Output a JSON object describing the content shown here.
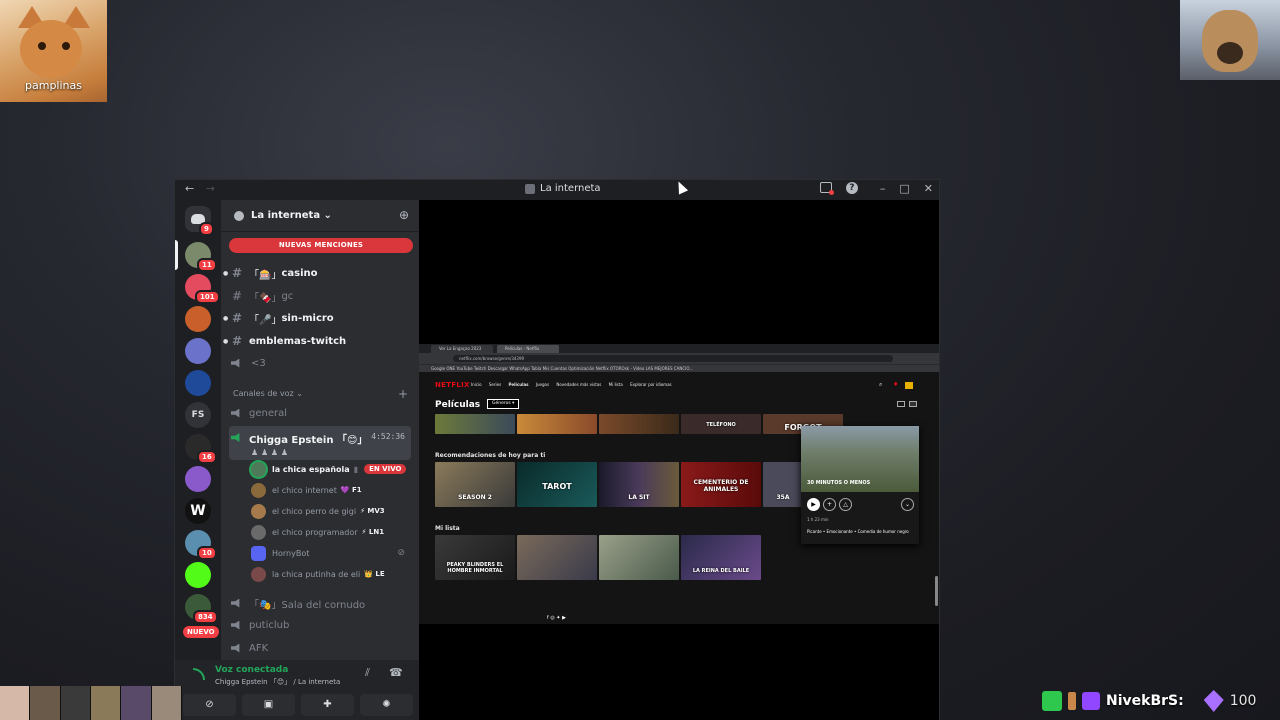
{
  "webcams": {
    "left_name": "pamplinas"
  },
  "window": {
    "title": "La interneta",
    "nav_back": "←",
    "nav_forward": "→",
    "help": "?",
    "minimize": "–",
    "maximize": "□",
    "close": "✕"
  },
  "servers": [
    {
      "badge": "9"
    },
    {
      "badge": "11"
    },
    {
      "badge": "101"
    },
    {
      "badge": ""
    },
    {
      "badge": ""
    },
    {
      "badge": ""
    },
    {
      "label": "FS",
      "badge": ""
    },
    {
      "badge": "16"
    },
    {
      "badge": ""
    },
    {
      "label": "W",
      "badge": ""
    },
    {
      "badge": "10"
    },
    {
      "badge": ""
    },
    {
      "badge": "834"
    },
    {
      "label": "NUEVO"
    }
  ],
  "sidebar": {
    "server_name": "La interneta",
    "mention_banner": "NUEVAS MENCIONES",
    "text_channels": [
      {
        "name": "casino",
        "prefix": "「🎰」",
        "style": "bright"
      },
      {
        "name": "gc",
        "prefix": "「🍫」",
        "style": "dim"
      },
      {
        "name": "sin-micro",
        "prefix": "「🎤」",
        "style": "bright"
      },
      {
        "name": "emblemas-twitch",
        "prefix": "",
        "style": "bright"
      },
      {
        "name": "<3",
        "prefix": "",
        "style": "dim"
      }
    ],
    "voice_category": "Canales de voz",
    "voice_channels": [
      {
        "name": "general"
      },
      {
        "name": "Chigga Epstein 「😊」",
        "time": "4:52:36"
      },
      {
        "name": "「🎭」Sala del cornudo"
      },
      {
        "name": "puticlub"
      },
      {
        "name": "AFK"
      }
    ],
    "voice_users": [
      {
        "name": "la chica española",
        "tag": "",
        "live": "EN VIVO"
      },
      {
        "name": "el chico internet",
        "tag": "💜 F1"
      },
      {
        "name": "el chico perro de gigi",
        "tag": "⚡ MV3"
      },
      {
        "name": "el chico programador",
        "tag": "⚡ LN1"
      },
      {
        "name": "HornyBot",
        "tag": ""
      },
      {
        "name": "la chica putinha de eli",
        "tag": "👑 LE"
      }
    ]
  },
  "voice_panel": {
    "status": "Voz conectada",
    "channel": "Chigga Epstein 「😊」 / La interneta"
  },
  "stream": {
    "browser_tabs": [
      "Ver La Engaçao 2023 Online",
      "Películas - Netflix"
    ],
    "url": "netflix.com/browse/genre/34399",
    "bookmarks": "Google   ONE YouTube   Twitch   Descargar WhatsApp   Tabla Mis Cuentas   Optimización Netflix   OTOROsk - Video   LAS MEJORES CANCIO...",
    "logo": "NETFLIX",
    "nav": [
      "Inicio",
      "Series",
      "Películas",
      "Juegos",
      "Novedades más vistas",
      "Mi lista",
      "Explorar por idiomas"
    ],
    "page_title": "Películas",
    "genre_button": "Géneros ▾",
    "row2_label": "Recomendaciones de hoy para ti",
    "row3_label": "Mi lista",
    "row2_titles": [
      "SEASON 2",
      "TAROT",
      "LA SIT",
      "",
      "CEMENTERIO DE ANIMALES",
      "",
      "35A"
    ],
    "row3_titles": [
      "PEAKY BLINDERS EL HOMBRE INMORTAL",
      "",
      "",
      "LA REINA DEL BAILE"
    ],
    "strip_titles": [
      "",
      "",
      "TELÉFONO",
      "FORGOT"
    ],
    "popup": {
      "title": "30 MINUTOS O MENOS",
      "meta": "1 h 23 min",
      "tags": "Picante  •  Emocionante  •  Comedia de humor negro"
    },
    "footer_icons": "f  ◎  ✦  ▶"
  },
  "overlay": {
    "streamer_name": "NivekBrS:",
    "points": "100"
  }
}
